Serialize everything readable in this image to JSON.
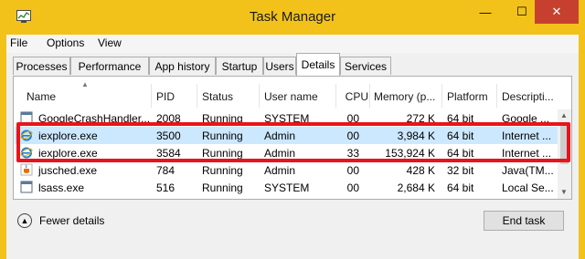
{
  "window": {
    "title": "Task Manager",
    "controls": {
      "minimize": "—",
      "maximize": "☐",
      "close": "✕"
    },
    "frame_color": "#f3c21a",
    "close_color": "#c7402f"
  },
  "menu": [
    "File",
    "Options",
    "View"
  ],
  "tabs": [
    "Processes",
    "Performance",
    "App history",
    "Startup",
    "Users",
    "Details",
    "Services"
  ],
  "active_tab": "Details",
  "columns": [
    "Name",
    "PID",
    "Status",
    "User name",
    "CPU",
    "Memory (p...",
    "Platform",
    "Descripti..."
  ],
  "rows": [
    {
      "name": "GoogleCrashHandler...",
      "pid": "2008",
      "status": "Running",
      "user": "SYSTEM",
      "cpu": "00",
      "memory": "272 K",
      "platform": "64 bit",
      "desc": "Google ...",
      "icon": "generic-app-icon"
    },
    {
      "name": "iexplore.exe",
      "pid": "3500",
      "status": "Running",
      "user": "Admin",
      "cpu": "00",
      "memory": "3,984 K",
      "platform": "64 bit",
      "desc": "Internet ...",
      "icon": "internet-explorer-icon",
      "selected": true
    },
    {
      "name": "iexplore.exe",
      "pid": "3584",
      "status": "Running",
      "user": "Admin",
      "cpu": "33",
      "memory": "153,924 K",
      "platform": "64 bit",
      "desc": "Internet ...",
      "icon": "internet-explorer-icon"
    },
    {
      "name": "jusched.exe",
      "pid": "784",
      "status": "Running",
      "user": "Admin",
      "cpu": "00",
      "memory": "428 K",
      "platform": "32 bit",
      "desc": "Java(TM...",
      "icon": "java-icon"
    },
    {
      "name": "lsass.exe",
      "pid": "516",
      "status": "Running",
      "user": "SYSTEM",
      "cpu": "00",
      "memory": "2,684 K",
      "platform": "64 bit",
      "desc": "Local Se...",
      "icon": "generic-app-icon"
    }
  ],
  "highlight_color": "#e8141b",
  "selection_color": "#cce8ff",
  "footer": {
    "fewer_details": "Fewer details",
    "end_task": "End task"
  }
}
